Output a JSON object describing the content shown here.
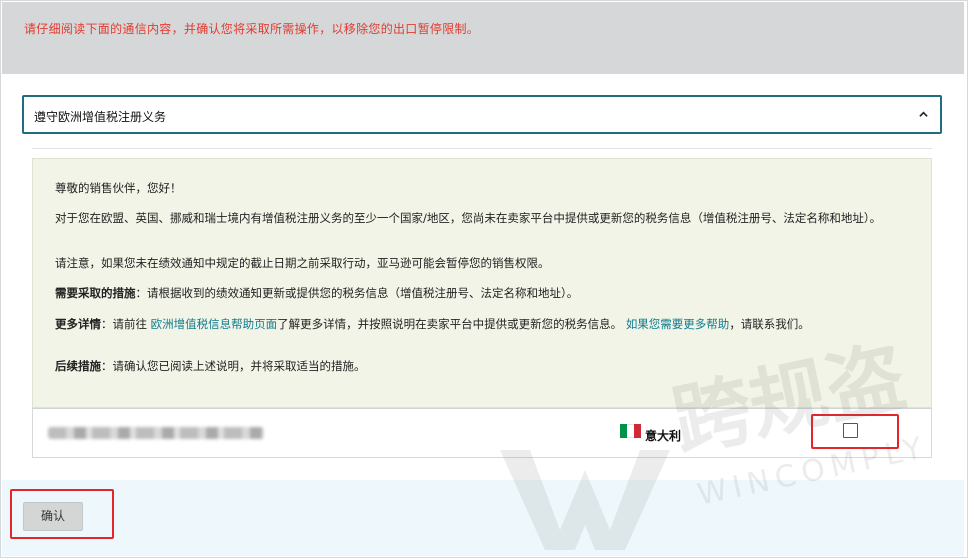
{
  "banner": {
    "message": "请仔细阅读下面的通信内容，并确认您将采取所需操作，以移除您的出口暂停限制。"
  },
  "accordion": {
    "title": "遵守欧洲增值税注册义务"
  },
  "notice": {
    "greeting": "尊敬的销售伙伴，您好！",
    "para1": "对于您在欧盟、英国、挪威和瑞士境内有增值税注册义务的至少一个国家/地区，您尚未在卖家平台中提供或更新您的税务信息（增值税注册号、法定名称和地址）。",
    "para2": "请注意，如果您未在绩效通知中规定的截止日期之前采取行动，亚马逊可能会暂停您的销售权限。",
    "action_label": "需要采取的措施",
    "action_text": "：请根据收到的绩效通知更新或提供您的税务信息（增值税注册号、法定名称和地址）。",
    "more_label": "更多详情",
    "more_text_1": "：请前往 ",
    "more_link_1": "欧洲增值税信息帮助页面",
    "more_text_2": "了解更多详情，并按照说明在卖家平台中提供或更新您的税务信息。 ",
    "more_link_2": "如果您需要更多帮助",
    "more_text_3": "，请联系我们。",
    "follow_label": "后续措施",
    "follow_text": "：请确认您已阅读上述说明，并将采取适当的措施。"
  },
  "store_row": {
    "country": "意大利",
    "flag_colors": [
      "#009246",
      "#ffffff",
      "#ce2b37"
    ]
  },
  "footer": {
    "confirm_label": "确认"
  },
  "watermark": {
    "text_cn": "跨规盗",
    "text_en": "WINCOMPLY"
  },
  "colors": {
    "banner_text": "#e23b2e",
    "accent": "#1f6e80",
    "highlight": "#e3262a",
    "notice_bg": "#f1f4e6"
  }
}
